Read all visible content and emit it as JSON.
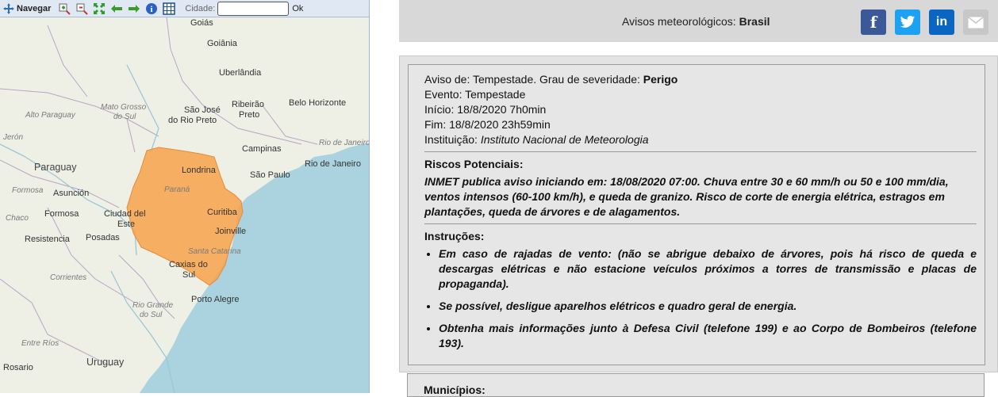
{
  "toolbar": {
    "navigate_label": "Navegar",
    "city_label": "Cidade:",
    "city_value": "",
    "ok_label": "Ok",
    "icons": [
      "move-icon",
      "zoom-in-icon",
      "zoom-out-icon",
      "zoom-extent-icon",
      "back-arrow-icon",
      "forward-arrow-icon",
      "info-icon",
      "grid-icon"
    ]
  },
  "map": {
    "labels": {
      "goiania": "Goiânia",
      "uberlandia": "Uberlândia",
      "mato_grosso_do_sul_1": "Mato Grosso",
      "mato_grosso_do_sul_2": "do Sul",
      "sao_jose_1": "São José",
      "sao_jose_2": "do Rio Preto",
      "ribeirao_1": "Ribeirão",
      "ribeirao_2": "Preto",
      "belo_horizonte": "Belo Horizonte",
      "alto_paraguay": "Alto Paraguay",
      "jeron": "Jerón",
      "campinas": "Campinas",
      "rio_de_janeiro_it": "Rio de Janeiro",
      "paraguay": "Paraguay",
      "londrina": "Londrina",
      "sao_paulo": "São Paulo",
      "rio_de_janeiro": "Rio de Janeiro",
      "formosa_it": "Formosa",
      "asuncion": "Asunción",
      "parana": "Paraná",
      "chaco": "Chaco",
      "formosa": "Formosa",
      "ciudad_del_este_1": "Ciudad del",
      "ciudad_del_este_2": "Este",
      "curitiba": "Curitiba",
      "joinville": "Joinville",
      "resistencia": "Resistencia",
      "posadas": "Posadas",
      "santa_catarina": "Santa Catarina",
      "caxias_1": "Caxias do",
      "caxias_2": "Sul",
      "corrientes": "Corrientes",
      "porto_alegre": "Porto Alegre",
      "rio_grande_1": "Rio Grande",
      "rio_grande_2": "do Sul",
      "entre_rios": "Entre Ríos",
      "uruguay": "Uruguay",
      "rosario": "Rosario",
      "top_city": "Goiás"
    },
    "alert_area_color": "#f7a24b",
    "sea_color": "#aad3df",
    "land_color": "#eef0e6"
  },
  "share": {
    "title_prefix": "Avisos meteorológicos: ",
    "title_region": "Brasil",
    "facebook_glyph": "f",
    "linkedin_glyph": "in"
  },
  "alert": {
    "aviso_prefix": "Aviso de: Tempestade. Grau de severidade: ",
    "severity": "Perigo",
    "evento": "Evento: Tempestade",
    "inicio": "Início: 18/8/2020 7h0min",
    "fim": "Fim: 18/8/2020 23h59min",
    "instituicao_prefix": "Instituição: ",
    "instituicao": "Instituto Nacional de Meteorologia",
    "riscos_title": "Riscos Potenciais:",
    "riscos_text": "INMET publica aviso iniciando em: 18/08/2020 07:00. Chuva entre 30 e 60 mm/h ou 50 e 100 mm/dia, ventos intensos (60-100 km/h), e queda de granizo. Risco de corte de energia elétrica, estragos em plantações, queda de árvores e de alagamentos.",
    "instrucoes_title": "Instruções:",
    "instrucoes": [
      "Em caso de rajadas de vento: (não se abrigue debaixo de árvores, pois há risco de queda e descargas elétricas e não estacione veículos próximos a torres de transmissão e placas de propaganda).",
      "Se possível, desligue aparelhos elétricos e quadro geral de energia.",
      "Obtenha mais informações junto à Defesa Civil (telefone 199) e ao Corpo de Bombeiros (telefone 193)."
    ],
    "municipios_title": "Municípios:"
  }
}
